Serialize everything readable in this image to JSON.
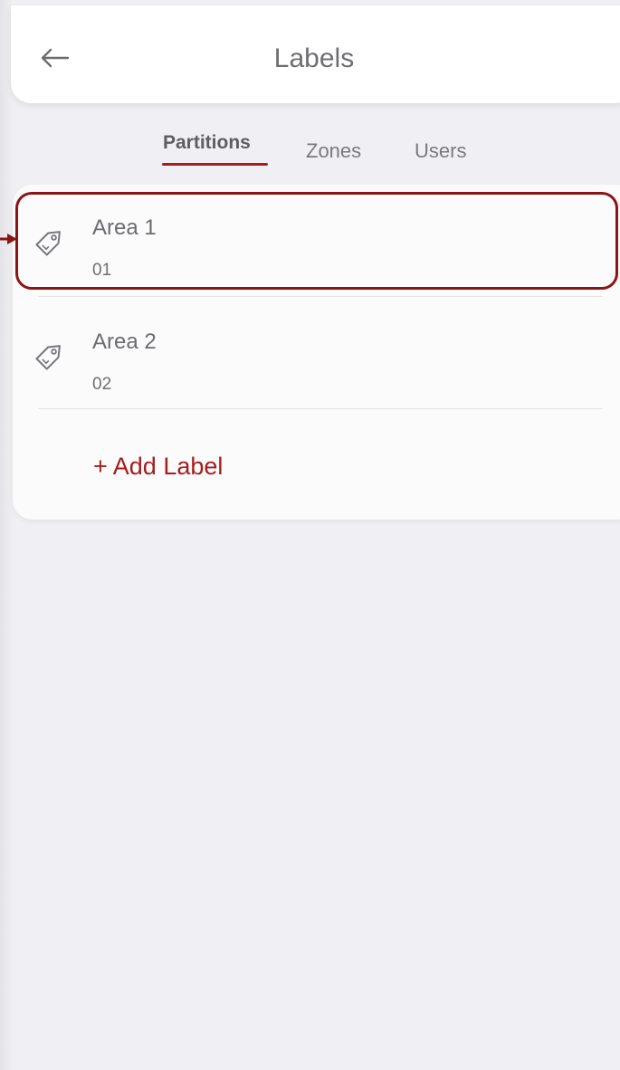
{
  "header": {
    "title": "Labels",
    "back_icon": "arrow-left-icon"
  },
  "tabs": [
    {
      "label": "Partitions",
      "active": true
    },
    {
      "label": "Zones",
      "active": false
    },
    {
      "label": "Users",
      "active": false
    }
  ],
  "labels": [
    {
      "name": "Area 1",
      "code": "01",
      "icon": "tag-icon",
      "highlighted": true
    },
    {
      "name": "Area 2",
      "code": "02",
      "icon": "tag-icon",
      "highlighted": false
    }
  ],
  "add_label": "+ Add Label",
  "colors": {
    "accent": "#a41d1d",
    "highlight_border": "#8b1515",
    "background": "#f0eff4",
    "card": "#fbfbfc"
  }
}
